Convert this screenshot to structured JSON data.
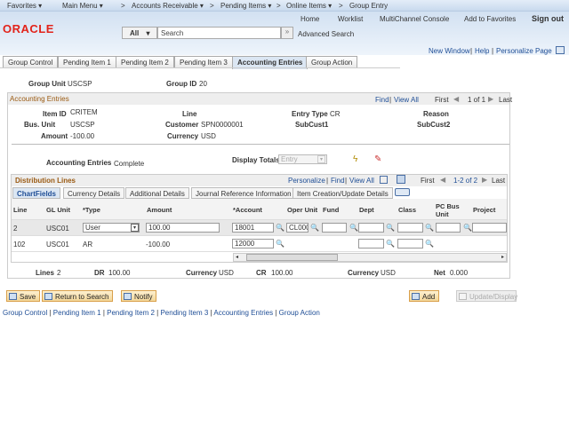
{
  "nav": {
    "items": [
      "Favorites ▾",
      "Main Menu ▾",
      "Accounts Receivable ▾",
      "Pending Items ▾",
      "Online Items ▾",
      "Group Entry"
    ]
  },
  "header": {
    "links": [
      "Home",
      "Worklist",
      "MultiChannel Console",
      "Add to Favorites"
    ],
    "signout": "Sign out",
    "logo": "ORACLE",
    "search_scope": "All",
    "search_placeholder": "Search",
    "advanced": "Advanced Search"
  },
  "toplinks": {
    "new_window": "New Window",
    "help": "Help",
    "personalize": "Personalize Page"
  },
  "tabs": [
    "Group Control",
    "Pending Item 1",
    "Pending Item 2",
    "Pending Item 3",
    "Accounting Entries",
    "Group Action"
  ],
  "group": {
    "unit_label": "Group Unit",
    "unit": "USCSP",
    "id_label": "Group ID",
    "id": "20"
  },
  "acct": {
    "title": "Accounting Entries",
    "find": "Find",
    "viewall": "View All",
    "first": "First",
    "count": "1 of 1",
    "last": "Last",
    "item_id_label": "Item ID",
    "item_id": "CRITEM",
    "line_label": "Line",
    "entry_type_label": "Entry Type",
    "entry_type": "CR",
    "reason_label": "Reason",
    "bus_unit_label": "Bus. Unit",
    "bus_unit": "USCSP",
    "customer_label": "Customer",
    "customer": "SPN0000001",
    "subcust1_label": "SubCust1",
    "subcust2_label": "SubCust2",
    "amount_label": "Amount",
    "amount": "-100.00",
    "currency_label": "Currency",
    "currency": "USD",
    "status_label": "Accounting Entries",
    "status": "Complete",
    "totals_label": "Display Totals",
    "totals_value": "Entry"
  },
  "dist": {
    "title": "Distribution Lines",
    "personalize": "Personalize",
    "find": "Find",
    "viewall": "View All",
    "first": "First",
    "count": "1-2 of 2",
    "last": "Last",
    "subtabs": [
      "ChartFields",
      "Currency Details",
      "Additional Details",
      "Journal Reference Information",
      "Item Creation/Update Details"
    ],
    "columns": [
      "Line",
      "GL Unit",
      "*Type",
      "Amount",
      "*Account",
      "Oper Unit",
      "Fund",
      "Dept",
      "Class",
      "PC Bus Unit",
      "Project"
    ],
    "rows": [
      {
        "line": "2",
        "gl_unit": "USC01",
        "type": "User",
        "amount": "100.00",
        "account": "18001",
        "oper_unit": "CL000"
      },
      {
        "line": "102",
        "gl_unit": "USC01",
        "type": "AR",
        "amount": "-100.00",
        "account": "12000"
      }
    ],
    "totals": {
      "lines_label": "Lines",
      "lines": "2",
      "dr_label": "DR",
      "dr": "100.00",
      "cur1_label": "Currency",
      "cur1": "USD",
      "cr_label": "CR",
      "cr": "100.00",
      "cur2_label": "Currency",
      "cur2": "USD",
      "net_label": "Net",
      "net": "0.000"
    }
  },
  "buttons": {
    "save": "Save",
    "return": "Return to Search",
    "notify": "Notify",
    "add": "Add",
    "update": "Update/Display"
  },
  "footer_links": [
    "Group Control",
    "Pending Item 1",
    "Pending Item 2",
    "Pending Item 3",
    "Accounting Entries",
    "Group Action"
  ]
}
